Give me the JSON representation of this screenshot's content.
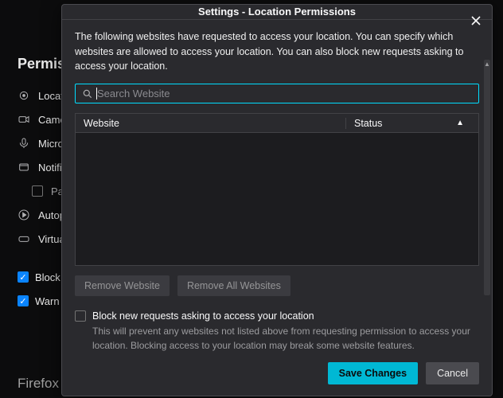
{
  "backpage": {
    "section_heading": "Permissions",
    "items": [
      {
        "label": "Location",
        "icon": "location"
      },
      {
        "label": "Camera",
        "icon": "camera"
      },
      {
        "label": "Microphone",
        "icon": "microphone"
      },
      {
        "label": "Notifications",
        "icon": "notifications"
      }
    ],
    "sub_item": {
      "label": "Pause",
      "checked": false
    },
    "extra_items": [
      {
        "label": "Autoplay",
        "icon": "autoplay"
      },
      {
        "label": "Virtual Reality",
        "icon": "vr"
      }
    ],
    "checks": [
      {
        "label": "Block pop-up windows",
        "checked": true
      },
      {
        "label": "Warn you",
        "checked": true
      }
    ],
    "footer_heading": "Firefox Data Collection and Use"
  },
  "dialog": {
    "title": "Settings - Location Permissions",
    "intro": "The following websites have requested to access your location. You can specify which websites are allowed to access your location. You can also block new requests asking to access your location.",
    "search_placeholder": "Search Website",
    "table": {
      "col_website": "Website",
      "col_status": "Status",
      "rows": []
    },
    "buttons": {
      "remove_one": "Remove Website",
      "remove_all": "Remove All Websites",
      "save": "Save Changes",
      "cancel": "Cancel"
    },
    "block_new": {
      "label": "Block new requests asking to access your location",
      "checked": false,
      "description": "This will prevent any websites not listed above from requesting permission to access your location. Blocking access to your location may break some website features."
    }
  },
  "colors": {
    "accent": "#00ddff",
    "primary_btn": "#00b8d4"
  }
}
